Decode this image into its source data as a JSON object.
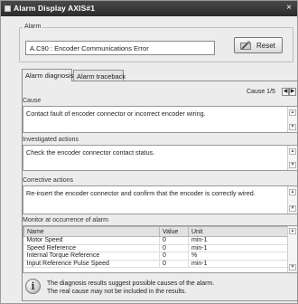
{
  "window": {
    "title": "Alarm Display AXIS#1",
    "close_glyph": "×"
  },
  "alarm_group": {
    "label": "Alarm",
    "current_alarm": "A.C90 : Encoder Communications Error",
    "reset_label": "Reset"
  },
  "tabs": [
    {
      "label": "Alarm diagnosis",
      "active": true
    },
    {
      "label": "Alarm traceback",
      "active": false
    }
  ],
  "cause": {
    "label": "Cause",
    "counter": "Cause 1/5",
    "text": "Contact fault of encoder connector or incorrect encoder wiring."
  },
  "investigated": {
    "label": "Investigated actions",
    "text": "Check the encoder connector contact status."
  },
  "corrective": {
    "label": "Corrective actions",
    "text": "Re-insert the encoder connector and confirm that the encoder is correctly wired."
  },
  "monitor": {
    "label": "Monitor at occurrence of alarm",
    "columns": [
      "Name",
      "Value",
      "Unit"
    ],
    "rows": [
      [
        "Motor Speed",
        "0",
        "min-1"
      ],
      [
        "Speed Reference",
        "0",
        "min-1"
      ],
      [
        "Internal Torque Reference",
        "0",
        "%"
      ],
      [
        "Input Reference Pulse Speed",
        "0",
        "min-1"
      ]
    ]
  },
  "note": {
    "line1": "The diagnosis results suggest possible causes of the alarm.",
    "line2": "The real cause may not be included in the results."
  },
  "icons": {
    "info": "i",
    "nav_prev": "◀",
    "nav_next": "▶",
    "scroll_up": "▲",
    "scroll_down": "▼"
  }
}
